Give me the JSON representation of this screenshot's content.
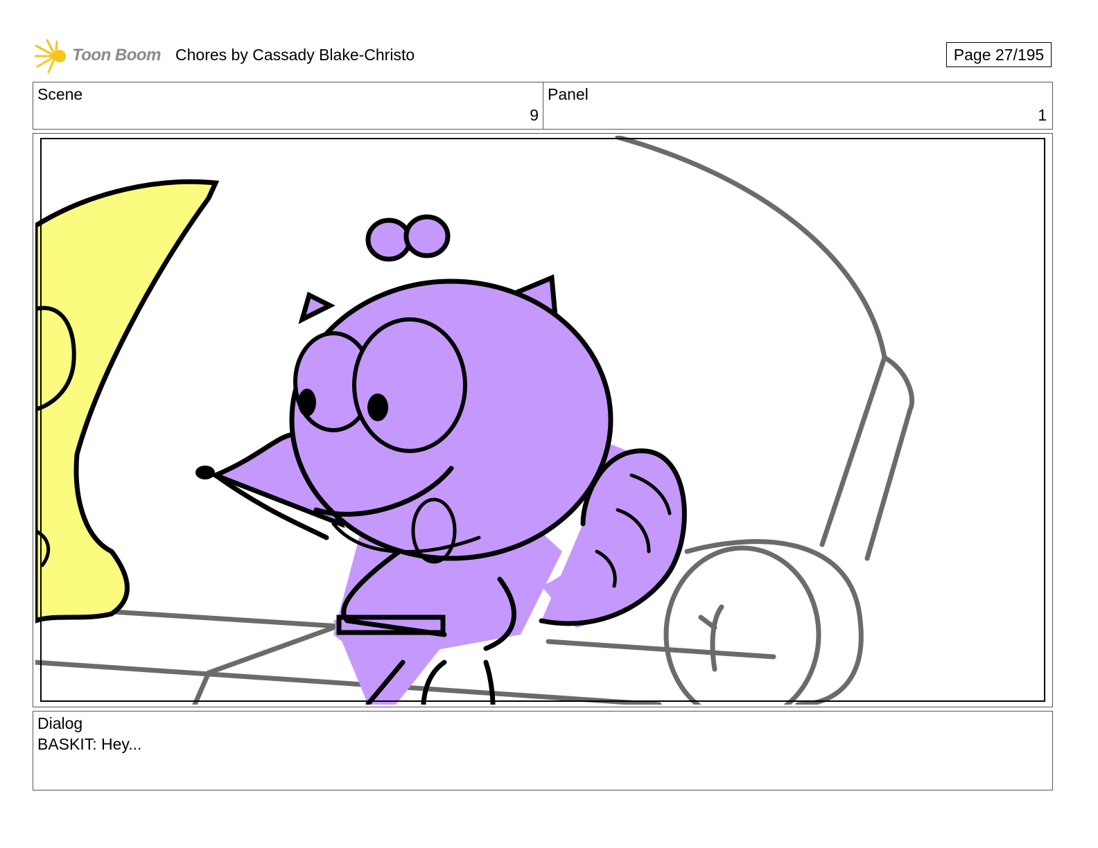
{
  "header": {
    "logo_text": "Toon Boom",
    "logo_color": "#f5c518",
    "title": "Chores  by Cassady Blake-Christo",
    "page_label": "Page  27/195"
  },
  "scene": {
    "label": "Scene",
    "value": "9"
  },
  "panel": {
    "label": "Panel",
    "value": "1"
  },
  "dialog": {
    "label": "Dialog",
    "text": "BASKIT: Hey..."
  },
  "colors": {
    "character_fill": "#c599fb",
    "yellow_character": "#fbfb80",
    "furniture_stroke": "#6b6b6b"
  }
}
